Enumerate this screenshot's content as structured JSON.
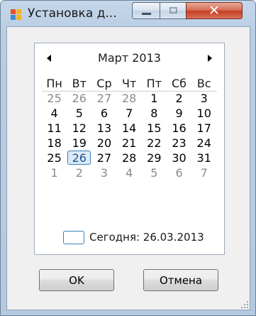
{
  "window": {
    "title": "Установка д...",
    "colors": {
      "frame": "#b9cde3",
      "close": "#c44126",
      "today_outline": "#3c7fb1"
    }
  },
  "calendar": {
    "month_title": "Март 2013",
    "weekdays": [
      "Пн",
      "Вт",
      "Ср",
      "Чт",
      "Пт",
      "Сб",
      "Вс"
    ],
    "weeks": [
      [
        "25",
        "26",
        "27",
        "28",
        "1",
        "2",
        "3"
      ],
      [
        "4",
        "5",
        "6",
        "7",
        "8",
        "9",
        "10"
      ],
      [
        "11",
        "12",
        "13",
        "14",
        "15",
        "16",
        "17"
      ],
      [
        "18",
        "19",
        "20",
        "21",
        "22",
        "23",
        "24"
      ],
      [
        "25",
        "26",
        "27",
        "28",
        "29",
        "30",
        "31"
      ],
      [
        "1",
        "2",
        "3",
        "4",
        "5",
        "6",
        "7"
      ]
    ],
    "selected_day": "26",
    "today_label": "Сегодня: 26.03.2013",
    "icons": {
      "prev": "left-triangle",
      "next": "right-triangle"
    }
  },
  "buttons": {
    "ok": "OK",
    "cancel": "Отмена"
  }
}
